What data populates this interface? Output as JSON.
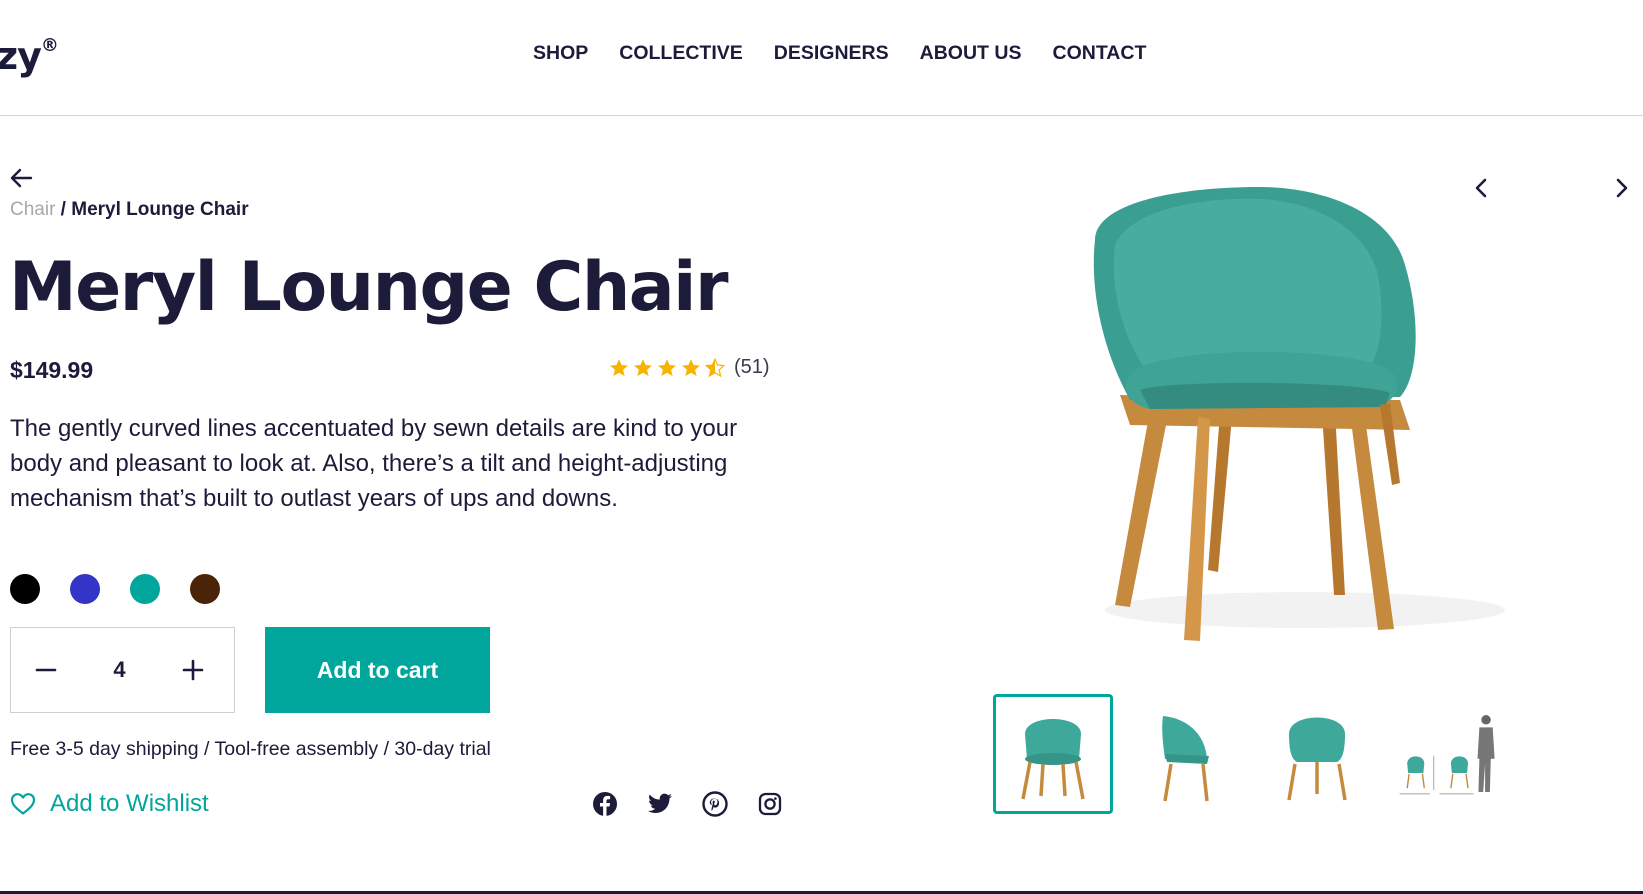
{
  "header": {
    "logo_text": "zy",
    "logo_mark": "®",
    "nav": [
      "SHOP",
      "COLLECTIVE",
      "DESIGNERS",
      "ABOUT US",
      "CONTACT"
    ]
  },
  "breadcrumb": {
    "parent": "Chair",
    "separator": " / ",
    "current": "Meryl Lounge Chair"
  },
  "product": {
    "title": "Meryl Lounge Chair",
    "price": "$149.99",
    "rating": {
      "value": 4.5,
      "max": 5,
      "count_label": "(51)"
    },
    "description": "The gently curved lines accentuated by sewn details are kind to your body and pleasant to look at. Also, there’s a tilt and height-adjusting mechanism that’s built to outlast years of ups and downs.",
    "colors": [
      "#000000",
      "#3434c8",
      "#00a69c",
      "#4a2408"
    ],
    "quantity": "4",
    "add_to_cart_label": "Add to cart",
    "shipping_info": "Free 3-5 day shipping / Tool-free assembly / 30-day trial",
    "wishlist_label": "Add to Wishlist"
  },
  "socials": [
    "facebook-icon",
    "twitter-icon",
    "pinterest-icon",
    "instagram-icon"
  ],
  "gallery": {
    "active_index": 0,
    "thumbnails": [
      "chair-front-view",
      "chair-side-view",
      "chair-back-view",
      "chair-dimensions-view"
    ]
  },
  "colors": {
    "accent": "#00a69c",
    "text": "#1c1c3a",
    "star": "#f6b400",
    "upholstery": "#3ea89a",
    "wood": "#c68a3e"
  }
}
